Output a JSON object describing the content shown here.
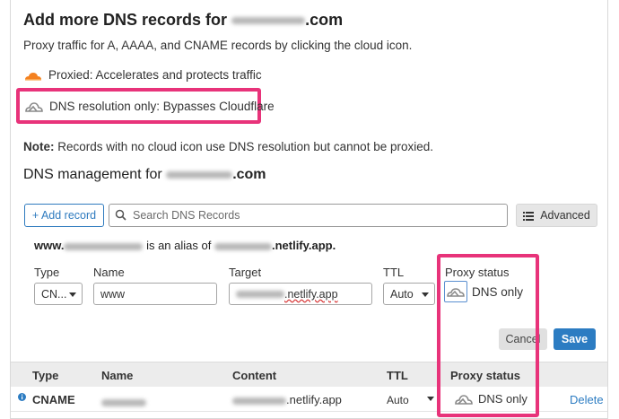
{
  "heading": {
    "prefix": "Add more DNS records for",
    "suffix": ".com"
  },
  "intro": "Proxy traffic for A, AAAA, and CNAME records by clicking the cloud icon.",
  "legend": {
    "proxied": "Proxied: Accelerates and protects traffic",
    "dns_only": "DNS resolution only: Bypasses Cloudflare"
  },
  "note": {
    "label": "Note:",
    "text": " Records with no cloud icon use DNS resolution but cannot be proxied."
  },
  "management": {
    "prefix": "DNS management for",
    "suffix": ".com"
  },
  "toolbar": {
    "add_record": "+ Add record",
    "search_placeholder": "Search DNS Records",
    "advanced": "Advanced"
  },
  "alias": {
    "prefix": "www.",
    "middle": " is an alias of ",
    "suffix": ".netlify.app."
  },
  "form": {
    "type_label": "Type",
    "type_value": "CN...",
    "name_label": "Name",
    "name_value": "www",
    "target_label": "Target",
    "target_value": ".netlify.app",
    "ttl_label": "TTL",
    "ttl_value": "Auto",
    "proxy_label": "Proxy status",
    "proxy_value": "DNS only",
    "cancel": "Cancel",
    "save": "Save"
  },
  "table": {
    "columns": [
      "Type",
      "Name",
      "Content",
      "TTL",
      "Proxy status"
    ],
    "row": {
      "type": "CNAME",
      "content": ".netlify.app",
      "ttl": "Auto",
      "proxy": "DNS only",
      "action": "Delete"
    }
  },
  "colors": {
    "highlight": "#e8337a",
    "accent": "#2c7cc2",
    "proxied_cloud": "#f48120",
    "dns_only_cloud": "#8a8a8a"
  }
}
